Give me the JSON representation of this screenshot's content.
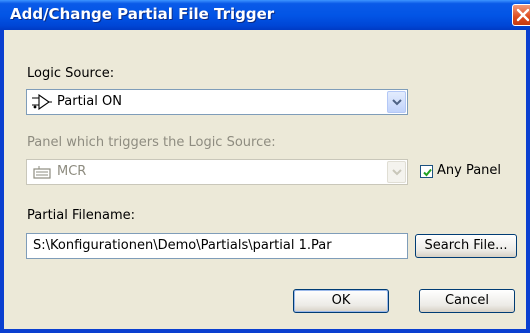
{
  "window": {
    "title": "Add/Change Partial File Trigger"
  },
  "logic_source": {
    "label": "Logic Source:",
    "value": "Partial ON",
    "icon": "logic-gate-icon"
  },
  "panel": {
    "label": "Panel which triggers the Logic Source:",
    "value": "MCR",
    "icon": "keyboard-icon",
    "enabled": false
  },
  "any_panel": {
    "label": "Any Panel",
    "checked": true
  },
  "partial_filename": {
    "label": "Partial Filename:",
    "value": "S:\\Konfigurationen\\Demo\\Partials\\partial 1.Par"
  },
  "buttons": {
    "search": "Search File...",
    "ok": "OK",
    "cancel": "Cancel"
  },
  "colors": {
    "titlebar": "#0255e6",
    "dialog_bg": "#ece9d8",
    "close_button": "#dd4c1e",
    "input_border": "#7f9db9"
  }
}
